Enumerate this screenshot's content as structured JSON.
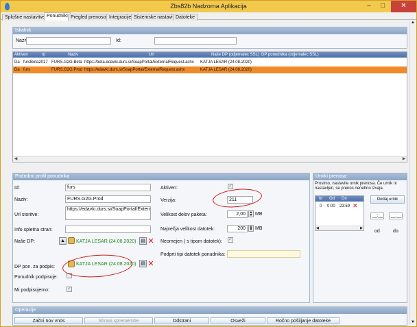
{
  "window": {
    "title": "Zbs82b Nadzorna Aplikacija",
    "min": "–",
    "max": "□",
    "close": "✕"
  },
  "tabs": [
    {
      "label": "Splošne nastavitve"
    },
    {
      "label": "Ponudniki"
    },
    {
      "label": "Pregled prenosov"
    },
    {
      "label": "Integracije"
    },
    {
      "label": "Sistemske nastavitve"
    },
    {
      "label": "Datoteke"
    }
  ],
  "search": {
    "header": "Iskalnik",
    "naziv_label": "Naziv:",
    "naziv_value": "",
    "id_label": "Id:",
    "id_value": ""
  },
  "grid": {
    "columns": [
      "Aktiven",
      "Id",
      "Naziv",
      "Url",
      "Naše DP (odjemalec SSL)",
      "DP ponudnika (odjemalec SSL)"
    ],
    "rows": [
      {
        "aktiven": "Da",
        "id": "fursBeta2017",
        "naziv": "FURS.G2G.Beta",
        "url": "https://beta.edavki.durs.si/SoapPortal/ExternalRequest.ashx",
        "nase_dp": "KATJA LESAR (24.08.2020)",
        "dp_ponudnika": "",
        "selected": false
      },
      {
        "aktiven": "Da",
        "id": "furs",
        "naziv": "FURS.G2G.Prod",
        "url": "https://edavki.durs.si/SoapPortal/ExternalRequest.ashx",
        "nase_dp": "KATJA LESAR (24.08.2020)",
        "dp_ponudnika": "",
        "selected": true
      }
    ]
  },
  "profile": {
    "header": "Podrobni profil ponudnika",
    "id_label": "Id:",
    "id_value": "furs",
    "naziv_label": "Naziv:",
    "naziv_value": "FURS.G2G.Prod",
    "url_label": "Url storitve:",
    "url_value": "https://edavki.durs.si/SoapPortal/ExternalRequest.ashx",
    "info_label": "Info spletna stran:",
    "info_value": "",
    "nase_dp_label": "Naše DP:",
    "nase_dp_value": "KATJA LESAR (24.08.2020)",
    "dp_podpis_label": "DP pon. za podpis:",
    "dp_podpis_value": "KATJA LESAR (24.08.2020)",
    "ponudnik_podpisuje_label": "Ponudnik podpisuje:",
    "mi_podpisujemo_label": "Mi podpisujemo:",
    "aktiven_label": "Aktiven:",
    "verzija_label": "Verzija:",
    "verzija_value": "211",
    "velikost_label": "Velikost delov paketa:",
    "velikost_value": "2,00",
    "velikost_unit": "MB",
    "najvecja_label": "Največja velikost datotek:",
    "najvecja_value": "200",
    "najvecja_unit": "MB",
    "neomejen_label": "Neomejen ( s tipom datotek):",
    "tipi_label": "Podprti tipi datotek ponudnika:",
    "tipi_value": ""
  },
  "schedule": {
    "header": "Urniki prenosa",
    "info": "Prosimo, nastavite urnik prenosa. Če urnik ni nastavljen, se prenos nenehno izvaja.",
    "columns": [
      "Id",
      "Od",
      "Do"
    ],
    "row": {
      "id": "0",
      "od": "0:00",
      "do": "23:59"
    },
    "add_label": "Dodaj urnik",
    "from_label": "od",
    "to_label": "do",
    "time_placeholder": "__:__"
  },
  "operations": {
    "header": "Operacije",
    "buttons": [
      "Začni nov vnos",
      "Shrani spremembe",
      "Odstrani",
      "Osveži",
      "Ročno pošiljanje datoteke"
    ]
  },
  "colors": {
    "title_bar": "#f2c94c",
    "selected_row": "#f08a28",
    "annotation": "#d01818"
  }
}
